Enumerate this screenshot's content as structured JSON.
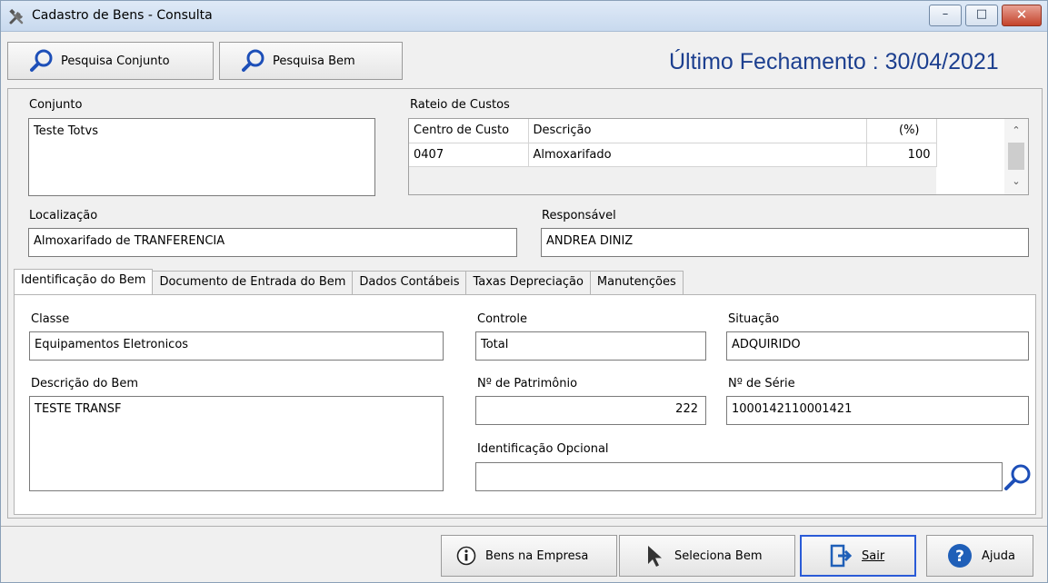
{
  "window": {
    "title": "Cadastro de Bens - Consulta",
    "controls": {
      "minimize": "–",
      "maximize": "□",
      "close": "✕"
    }
  },
  "toolbar": {
    "pesquisa_conjunto": "Pesquisa Conjunto",
    "pesquisa_bem": "Pesquisa Bem",
    "ultimo_fechamento": "Último Fechamento : 30/04/2021"
  },
  "conjunto": {
    "label": "Conjunto",
    "value": "Teste Totvs"
  },
  "rateio": {
    "label": "Rateio de Custos",
    "columns": [
      "Centro de Custo",
      "Descrição",
      "(%)"
    ],
    "rows": [
      [
        "0407",
        "Almoxarifado",
        "100"
      ]
    ]
  },
  "localizacao": {
    "label": "Localização",
    "value": "Almoxarifado de TRANFERENCIA"
  },
  "responsavel": {
    "label": "Responsável",
    "value": "ANDREA DINIZ"
  },
  "tabs": [
    {
      "label": "Identificação do Bem",
      "active": true
    },
    {
      "label": "Documento de Entrada do Bem",
      "active": false
    },
    {
      "label": "Dados Contábeis",
      "active": false
    },
    {
      "label": "Taxas Depreciação",
      "active": false
    },
    {
      "label": "Manutenções",
      "active": false
    }
  ],
  "identificacao": {
    "classe": {
      "label": "Classe",
      "value": "Equipamentos Eletronicos"
    },
    "controle": {
      "label": "Controle",
      "value": "Total"
    },
    "situacao": {
      "label": "Situação",
      "value": "ADQUIRIDO"
    },
    "descricao": {
      "label": "Descrição do Bem",
      "value": "TESTE TRANSF"
    },
    "patrimonio": {
      "label": "Nº de Patrimônio",
      "value": "222"
    },
    "serie": {
      "label": "Nº de Série",
      "value": "1000142110001421"
    },
    "opcional": {
      "label": "Identificação Opcional",
      "value": ""
    }
  },
  "bottom": {
    "bens_empresa": "Bens na Empresa",
    "seleciona_bem": "Seleciona Bem",
    "sair": "Sair",
    "ajuda": "Ajuda"
  },
  "colors": {
    "accent_text": "#1c3f8f",
    "focus_border": "#2a5bd7",
    "help_icon": "#1f5fb8"
  },
  "icons": [
    "tools-icon",
    "search-icon",
    "info-icon",
    "cursor-icon",
    "exit-icon",
    "help-icon"
  ]
}
